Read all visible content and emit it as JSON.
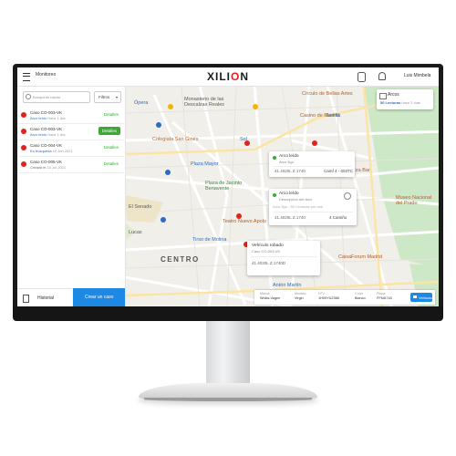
{
  "topbar": {
    "nav_title": "Monitoreo",
    "logo_main": "XILI",
    "logo_o": "O",
    "logo_end": "N",
    "user": "Luis Mimbela"
  },
  "panel": {
    "search_placeholder": "Búsqueda rápida",
    "filter_label": "Filtros",
    "cases": [
      {
        "id": "Caso CO-003-VK",
        "status": "Arco leído",
        "time": "Hace 1 día",
        "action": "Detalles"
      },
      {
        "id": "Caso CO-003-VK",
        "status": "Arco leído",
        "time": "Hace 1 día",
        "action": "Detalles"
      },
      {
        "id": "Caso CO-004-VK",
        "status": "En búsqueda",
        "time": "10 Jun 2021",
        "action": "Detalles"
      },
      {
        "id": "Caso CO-005-VK",
        "status": "Creado el",
        "time": "10 Jul 2021",
        "action": "Detalles"
      }
    ],
    "history_label": "Historial",
    "create_label": "Crear un caso"
  },
  "arcos": {
    "title": "Arcos",
    "count": "50 Lecturas",
    "since": "hace 2 días"
  },
  "popup1": {
    "title": "Arco leído",
    "sub": "Arco 5gu",
    "coords": "41.4020L Z.1740",
    "right": "Camf 4 - 003TC"
  },
  "popup2": {
    "title": "Arco leído",
    "sub": "Descripción del arco",
    "sub2": "Arco 5gu - 50 Lecturas por cas",
    "coords": "41.4020L Z.1740",
    "right": "4 Camiño"
  },
  "popup3": {
    "title": "Vehículo robado",
    "sub": "Caso CO-003-VK",
    "coords": "41.4020L Z.1740D"
  },
  "map": {
    "labels": [
      "Círculo de Bellas Artes",
      "Casino de Madrid",
      "Sevilla",
      "Monasterio de las Descalzas Reales",
      "Ópera",
      "Colegiata San Ginés",
      "Sol",
      "Plaza Mayor",
      "Plaza de Jacinto Benavente",
      "Teatro Nuevo Apolo",
      "Tirso de Molina",
      "CENTRO",
      "Antón Martín",
      "Brew Wild Pizza Bar",
      "Museo Nacional del Prado",
      "CaixaForum Madrid",
      "El Senado",
      "Lucas"
    ]
  },
  "info": {
    "cols": [
      {
        "label": "Marca",
        "value": "Wolks-Vagen"
      },
      {
        "label": "Modelo",
        "value": "Virgin"
      },
      {
        "label": "N°V",
        "value": "1H09YU2368"
      },
      {
        "label": "Color",
        "value": "Blanco"
      },
      {
        "label": "Placa",
        "value": "FFMA718"
      }
    ],
    "vehicle_button": "Vehículo"
  },
  "colors": {
    "accent": "#1e88e5",
    "success": "#3aaa35",
    "alert": "#e0231b"
  }
}
